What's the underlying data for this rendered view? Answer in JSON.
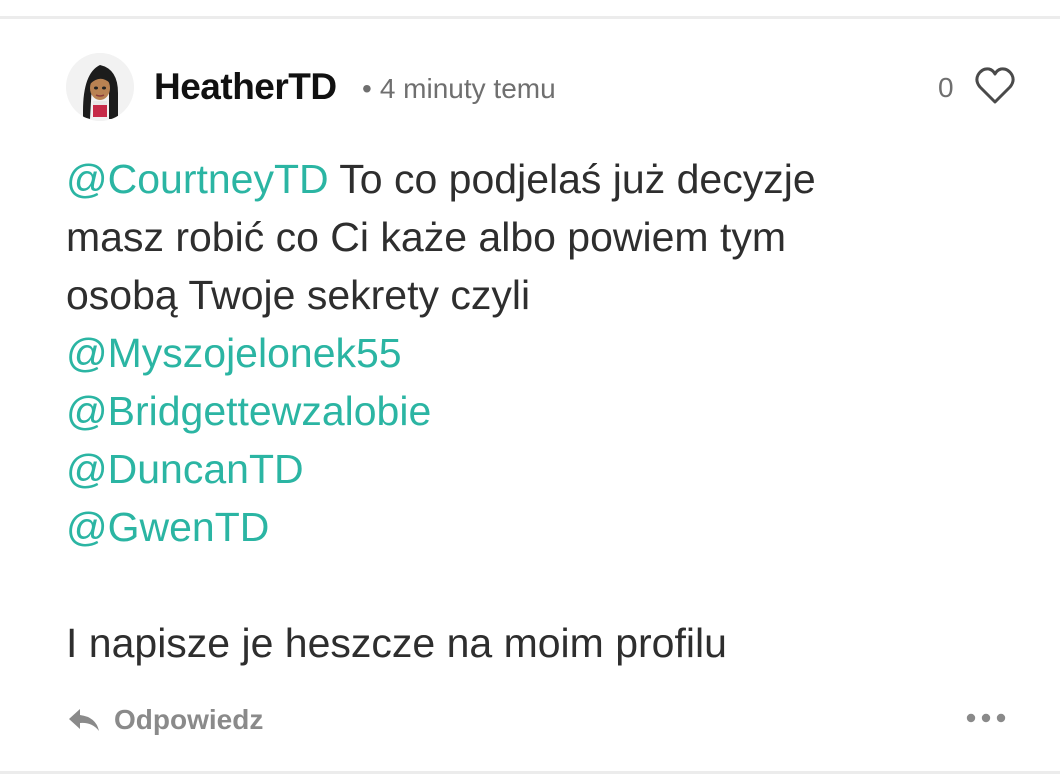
{
  "comment": {
    "author": "HeatherTD",
    "separator": "•",
    "timestamp": "4 minuty temu",
    "like_count": "0",
    "lines": [
      {
        "mention": "@CourtneyTD",
        "text": " To co podjelaś już decyzje"
      },
      {
        "mention": "",
        "text": "masz robić co Ci każe albo powiem tym"
      },
      {
        "mention": "",
        "text": "osobą Twoje sekrety czyli"
      },
      {
        "mention": "@Myszojelonek55",
        "text": ""
      },
      {
        "mention": "@Bridgettewzalobie",
        "text": ""
      },
      {
        "mention": "@DuncanTD",
        "text": ""
      },
      {
        "mention": "@GwenTD",
        "text": ""
      }
    ],
    "closing_line": "I napisze je heszcze na moim profilu"
  },
  "actions": {
    "reply_label": "Odpowiedz"
  },
  "colors": {
    "mention": "#2bb5a3",
    "text": "#2e2e2e",
    "muted": "#8a8a8a"
  },
  "icons": {
    "like": "heart-icon",
    "reply": "reply-arrow-icon",
    "more": "more-dots-icon"
  }
}
